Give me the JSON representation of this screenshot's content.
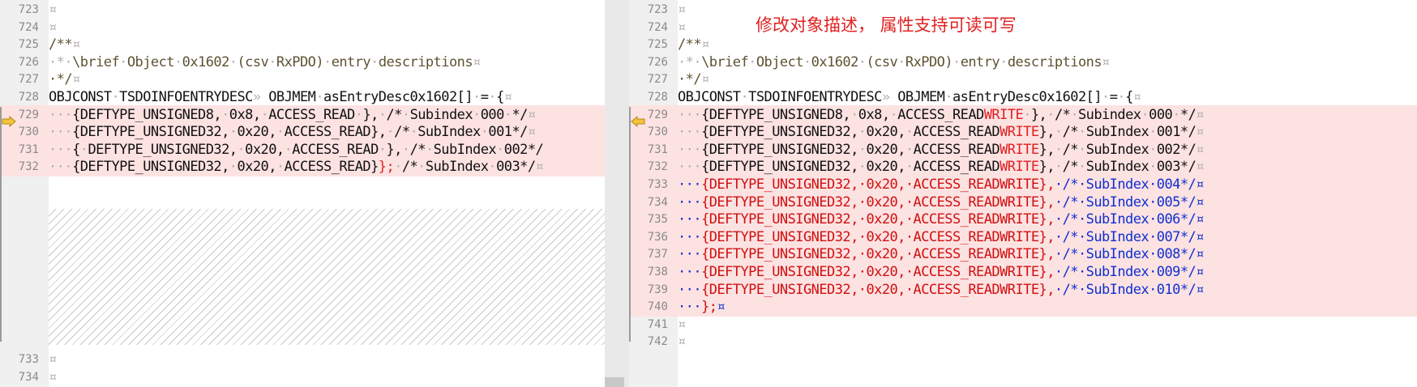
{
  "annotation": "修改对象描述， 属性支持可读可写",
  "left": {
    "lines_top": [
      {
        "n": "723",
        "kind": "blank",
        "segs": [
          {
            "t": "¤",
            "c": "ws"
          }
        ]
      },
      {
        "n": "724",
        "kind": "blank",
        "segs": [
          {
            "t": "¤",
            "c": "ws"
          }
        ]
      },
      {
        "n": "725",
        "kind": "comment",
        "segs": [
          {
            "t": "/**",
            "c": ""
          },
          {
            "t": "¤",
            "c": "ws"
          }
        ]
      },
      {
        "n": "726",
        "kind": "comment",
        "segs": [
          {
            "t": "·*·",
            "c": "ws"
          },
          {
            "t": "\\brief",
            "c": ""
          },
          {
            "t": "·",
            "c": "ws"
          },
          {
            "t": "Object",
            "c": ""
          },
          {
            "t": "·",
            "c": "ws"
          },
          {
            "t": "0x1602",
            "c": ""
          },
          {
            "t": "·",
            "c": "ws"
          },
          {
            "t": "(csv",
            "c": ""
          },
          {
            "t": "·",
            "c": "ws"
          },
          {
            "t": "RxPDO)",
            "c": ""
          },
          {
            "t": "·",
            "c": "ws"
          },
          {
            "t": "entry",
            "c": ""
          },
          {
            "t": "·",
            "c": "ws"
          },
          {
            "t": "descriptions",
            "c": ""
          },
          {
            "t": "¤",
            "c": "ws"
          }
        ]
      },
      {
        "n": "727",
        "kind": "comment",
        "segs": [
          {
            "t": "·*/",
            "c": ""
          },
          {
            "t": "¤",
            "c": "ws"
          }
        ]
      },
      {
        "n": "728",
        "kind": "code",
        "segs": [
          {
            "t": "OBJCONST",
            "c": ""
          },
          {
            "t": "·",
            "c": "ws"
          },
          {
            "t": "TSDOINFOENTRYDESC",
            "c": ""
          },
          {
            "t": "»",
            "c": "ws"
          },
          {
            "t": " OBJMEM",
            "c": ""
          },
          {
            "t": "·",
            "c": "ws"
          },
          {
            "t": "asEntryDesc0x1602[]",
            "c": ""
          },
          {
            "t": "·",
            "c": "ws"
          },
          {
            "t": "=",
            "c": ""
          },
          {
            "t": "·",
            "c": "ws"
          },
          {
            "t": "{",
            "c": ""
          },
          {
            "t": "¤",
            "c": "ws"
          }
        ]
      },
      {
        "n": "729",
        "kind": "changed",
        "segs": [
          {
            "t": "···",
            "c": "ws"
          },
          {
            "t": "{DEFTYPE_UNSIGNED8,",
            "c": ""
          },
          {
            "t": "·",
            "c": "ws"
          },
          {
            "t": "0x8,",
            "c": ""
          },
          {
            "t": "·",
            "c": "ws"
          },
          {
            "t": "ACCESS_READ",
            "c": ""
          },
          {
            "t": "·",
            "c": "ws"
          },
          {
            "t": "},",
            "c": ""
          },
          {
            "t": "·",
            "c": "ws"
          },
          {
            "t": "/*",
            "c": ""
          },
          {
            "t": "·",
            "c": "ws"
          },
          {
            "t": "Subindex",
            "c": ""
          },
          {
            "t": "·",
            "c": "ws"
          },
          {
            "t": "000",
            "c": ""
          },
          {
            "t": "·",
            "c": "ws"
          },
          {
            "t": "*/",
            "c": ""
          },
          {
            "t": "¤",
            "c": "ws"
          }
        ]
      },
      {
        "n": "730",
        "kind": "changed",
        "segs": [
          {
            "t": "···",
            "c": "ws"
          },
          {
            "t": "{DEFTYPE_UNSIGNED32,",
            "c": ""
          },
          {
            "t": "·",
            "c": "ws"
          },
          {
            "t": "0x20,",
            "c": ""
          },
          {
            "t": "·",
            "c": "ws"
          },
          {
            "t": "ACCESS_READ},",
            "c": ""
          },
          {
            "t": "·",
            "c": "ws"
          },
          {
            "t": "/*",
            "c": ""
          },
          {
            "t": "·",
            "c": "ws"
          },
          {
            "t": "SubIndex",
            "c": ""
          },
          {
            "t": "·",
            "c": "ws"
          },
          {
            "t": "001*/",
            "c": ""
          },
          {
            "t": "¤",
            "c": "ws"
          }
        ]
      },
      {
        "n": "731",
        "kind": "changed",
        "segs": [
          {
            "t": "···",
            "c": "ws"
          },
          {
            "t": "{",
            "c": ""
          },
          {
            "t": "·",
            "c": "ws"
          },
          {
            "t": "DEFTYPE_UNSIGNED32,",
            "c": ""
          },
          {
            "t": "·",
            "c": "ws"
          },
          {
            "t": "0x20,",
            "c": ""
          },
          {
            "t": "·",
            "c": "ws"
          },
          {
            "t": "ACCESS_READ",
            "c": ""
          },
          {
            "t": "·",
            "c": "ws"
          },
          {
            "t": "},",
            "c": ""
          },
          {
            "t": "·",
            "c": "ws"
          },
          {
            "t": "/*",
            "c": ""
          },
          {
            "t": "·",
            "c": "ws"
          },
          {
            "t": "SubIndex",
            "c": ""
          },
          {
            "t": "·",
            "c": "ws"
          },
          {
            "t": "002*/",
            "c": ""
          }
        ]
      },
      {
        "n": "732",
        "kind": "changed",
        "segs": [
          {
            "t": "···",
            "c": "ws"
          },
          {
            "t": "{DEFTYPE_UNSIGNED32,",
            "c": ""
          },
          {
            "t": "·",
            "c": "ws"
          },
          {
            "t": "0x20,",
            "c": ""
          },
          {
            "t": "·",
            "c": "ws"
          },
          {
            "t": "ACCESS_READ}",
            "c": ""
          },
          {
            "t": "};",
            "c": "ovr"
          },
          {
            "t": "·",
            "c": "ws"
          },
          {
            "t": "/*",
            "c": ""
          },
          {
            "t": "·",
            "c": "ws"
          },
          {
            "t": "SubIndex",
            "c": ""
          },
          {
            "t": "·",
            "c": "ws"
          },
          {
            "t": "003*/",
            "c": ""
          },
          {
            "t": "¤",
            "c": "ws"
          }
        ]
      }
    ],
    "lines_bottom": [
      {
        "n": "733",
        "kind": "blank",
        "segs": [
          {
            "t": "¤",
            "c": "ws"
          }
        ]
      },
      {
        "n": "734",
        "kind": "blank",
        "segs": [
          {
            "t": "¤",
            "c": "ws"
          }
        ]
      }
    ]
  },
  "right": {
    "lines": [
      {
        "n": "723",
        "kind": "blank",
        "segs": [
          {
            "t": "¤",
            "c": "ws"
          }
        ]
      },
      {
        "n": "724",
        "kind": "blank",
        "segs": [
          {
            "t": "¤",
            "c": "ws"
          }
        ]
      },
      {
        "n": "725",
        "kind": "comment",
        "segs": [
          {
            "t": "/**",
            "c": ""
          },
          {
            "t": "¤",
            "c": "ws"
          }
        ]
      },
      {
        "n": "726",
        "kind": "comment",
        "segs": [
          {
            "t": "·*·",
            "c": "ws"
          },
          {
            "t": "\\brief",
            "c": ""
          },
          {
            "t": "·",
            "c": "ws"
          },
          {
            "t": "Object",
            "c": ""
          },
          {
            "t": "·",
            "c": "ws"
          },
          {
            "t": "0x1602",
            "c": ""
          },
          {
            "t": "·",
            "c": "ws"
          },
          {
            "t": "(csv",
            "c": ""
          },
          {
            "t": "·",
            "c": "ws"
          },
          {
            "t": "RxPDO)",
            "c": ""
          },
          {
            "t": "·",
            "c": "ws"
          },
          {
            "t": "entry",
            "c": ""
          },
          {
            "t": "·",
            "c": "ws"
          },
          {
            "t": "descriptions",
            "c": ""
          },
          {
            "t": "¤",
            "c": "ws"
          }
        ]
      },
      {
        "n": "727",
        "kind": "comment",
        "segs": [
          {
            "t": "·*/",
            "c": ""
          },
          {
            "t": "¤",
            "c": "ws"
          }
        ]
      },
      {
        "n": "728",
        "kind": "code",
        "segs": [
          {
            "t": "OBJCONST",
            "c": ""
          },
          {
            "t": "·",
            "c": "ws"
          },
          {
            "t": "TSDOINFOENTRYDESC",
            "c": ""
          },
          {
            "t": "»",
            "c": "ws"
          },
          {
            "t": " OBJMEM",
            "c": ""
          },
          {
            "t": "·",
            "c": "ws"
          },
          {
            "t": "asEntryDesc0x1602[]",
            "c": ""
          },
          {
            "t": "·",
            "c": "ws"
          },
          {
            "t": "=",
            "c": ""
          },
          {
            "t": "·",
            "c": "ws"
          },
          {
            "t": "{",
            "c": ""
          },
          {
            "t": "¤",
            "c": "ws"
          }
        ]
      },
      {
        "n": "729",
        "kind": "changed",
        "segs": [
          {
            "t": "···",
            "c": "ws"
          },
          {
            "t": "{DEFTYPE_UNSIGNED8,",
            "c": ""
          },
          {
            "t": "·",
            "c": "ws"
          },
          {
            "t": "0x8,",
            "c": ""
          },
          {
            "t": "·",
            "c": "ws"
          },
          {
            "t": "ACCESS_READ",
            "c": ""
          },
          {
            "t": "WRITE",
            "c": "ovr"
          },
          {
            "t": "·",
            "c": "ws"
          },
          {
            "t": "},",
            "c": ""
          },
          {
            "t": "·",
            "c": "ws"
          },
          {
            "t": "/*",
            "c": ""
          },
          {
            "t": "·",
            "c": "ws"
          },
          {
            "t": "Subindex",
            "c": ""
          },
          {
            "t": "·",
            "c": "ws"
          },
          {
            "t": "000",
            "c": ""
          },
          {
            "t": "·",
            "c": "ws"
          },
          {
            "t": "*/",
            "c": ""
          },
          {
            "t": "¤",
            "c": "ws"
          }
        ]
      },
      {
        "n": "730",
        "kind": "changed",
        "segs": [
          {
            "t": "···",
            "c": "ws"
          },
          {
            "t": "{DEFTYPE_UNSIGNED32,",
            "c": ""
          },
          {
            "t": "·",
            "c": "ws"
          },
          {
            "t": "0x20,",
            "c": ""
          },
          {
            "t": "·",
            "c": "ws"
          },
          {
            "t": "ACCESS_READ",
            "c": ""
          },
          {
            "t": "WRITE",
            "c": "ovr"
          },
          {
            "t": "},",
            "c": ""
          },
          {
            "t": "·",
            "c": "ws"
          },
          {
            "t": "/*",
            "c": ""
          },
          {
            "t": "·",
            "c": "ws"
          },
          {
            "t": "SubIndex",
            "c": ""
          },
          {
            "t": "·",
            "c": "ws"
          },
          {
            "t": "001*/",
            "c": ""
          },
          {
            "t": "¤",
            "c": "ws"
          }
        ]
      },
      {
        "n": "731",
        "kind": "changed",
        "segs": [
          {
            "t": "···",
            "c": "ws"
          },
          {
            "t": "{DEFTYPE_UNSIGNED32,",
            "c": ""
          },
          {
            "t": "·",
            "c": "ws"
          },
          {
            "t": "0x20,",
            "c": ""
          },
          {
            "t": "·",
            "c": "ws"
          },
          {
            "t": "ACCESS_READ",
            "c": ""
          },
          {
            "t": "WRITE",
            "c": "ovr"
          },
          {
            "t": "},",
            "c": ""
          },
          {
            "t": "·",
            "c": "ws"
          },
          {
            "t": "/*",
            "c": ""
          },
          {
            "t": "·",
            "c": "ws"
          },
          {
            "t": "SubIndex",
            "c": ""
          },
          {
            "t": "·",
            "c": "ws"
          },
          {
            "t": "002*/",
            "c": ""
          },
          {
            "t": "¤",
            "c": "ws"
          }
        ]
      },
      {
        "n": "732",
        "kind": "changed",
        "segs": [
          {
            "t": "···",
            "c": "ws"
          },
          {
            "t": "{DEFTYPE_UNSIGNED32,",
            "c": ""
          },
          {
            "t": "·",
            "c": "ws"
          },
          {
            "t": "0x20,",
            "c": ""
          },
          {
            "t": "·",
            "c": "ws"
          },
          {
            "t": "ACCESS_READ",
            "c": ""
          },
          {
            "t": "WRITE",
            "c": "ovr"
          },
          {
            "t": "},",
            "c": ""
          },
          {
            "t": "·",
            "c": "ws"
          },
          {
            "t": "/*",
            "c": ""
          },
          {
            "t": "·",
            "c": "ws"
          },
          {
            "t": "SubIndex",
            "c": ""
          },
          {
            "t": "·",
            "c": "ws"
          },
          {
            "t": "003*/",
            "c": ""
          },
          {
            "t": "¤",
            "c": "ws"
          }
        ]
      },
      {
        "n": "733",
        "kind": "added",
        "segs": [
          {
            "t": "···",
            "c": "hl-blue"
          },
          {
            "t": "{DEFTYPE_UNSIGNED32,·0x20,·ACCESS_READWRITE},",
            "c": "hl-red"
          },
          {
            "t": "·/*·SubIndex·004*/¤",
            "c": "hl-blue"
          }
        ]
      },
      {
        "n": "734",
        "kind": "added",
        "segs": [
          {
            "t": "···",
            "c": "hl-blue"
          },
          {
            "t": "{DEFTYPE_UNSIGNED32,·0x20,·ACCESS_READWRITE},",
            "c": "hl-red"
          },
          {
            "t": "·/*·SubIndex·005*/¤",
            "c": "hl-blue"
          }
        ]
      },
      {
        "n": "735",
        "kind": "added",
        "segs": [
          {
            "t": "···",
            "c": "hl-blue"
          },
          {
            "t": "{DEFTYPE_UNSIGNED32,·0x20,·ACCESS_READWRITE},",
            "c": "hl-red"
          },
          {
            "t": "·/*·SubIndex·006*/¤",
            "c": "hl-blue"
          }
        ]
      },
      {
        "n": "736",
        "kind": "added",
        "segs": [
          {
            "t": "···",
            "c": "hl-blue"
          },
          {
            "t": "{DEFTYPE_UNSIGNED32,·0x20,·ACCESS_READWRITE},",
            "c": "hl-red"
          },
          {
            "t": "·/*·SubIndex·007*/¤",
            "c": "hl-blue"
          }
        ]
      },
      {
        "n": "737",
        "kind": "added",
        "segs": [
          {
            "t": "···",
            "c": "hl-blue"
          },
          {
            "t": "{DEFTYPE_UNSIGNED32,·0x20,·ACCESS_READWRITE},",
            "c": "hl-red"
          },
          {
            "t": "·/*·SubIndex·008*/¤",
            "c": "hl-blue"
          }
        ]
      },
      {
        "n": "738",
        "kind": "added",
        "segs": [
          {
            "t": "···",
            "c": "hl-blue"
          },
          {
            "t": "{DEFTYPE_UNSIGNED32,·0x20,·ACCESS_READWRITE},",
            "c": "hl-red"
          },
          {
            "t": "·/*·SubIndex·009*/¤",
            "c": "hl-blue"
          }
        ]
      },
      {
        "n": "739",
        "kind": "added",
        "segs": [
          {
            "t": "···",
            "c": "hl-blue"
          },
          {
            "t": "{DEFTYPE_UNSIGNED32,·0x20,·ACCESS_READWRITE},",
            "c": "hl-red"
          },
          {
            "t": "·/*·SubIndex·010*/¤",
            "c": "hl-blue"
          }
        ]
      },
      {
        "n": "740",
        "kind": "added",
        "segs": [
          {
            "t": "···",
            "c": "hl-blue"
          },
          {
            "t": "};",
            "c": "hl-red"
          },
          {
            "t": "¤",
            "c": "hl-blue"
          }
        ]
      },
      {
        "n": "741",
        "kind": "blank",
        "segs": [
          {
            "t": "¤",
            "c": "ws"
          }
        ]
      },
      {
        "n": "742",
        "kind": "blank",
        "segs": [
          {
            "t": "¤",
            "c": "ws"
          }
        ]
      }
    ]
  },
  "colors": {
    "changed_bg": "#fde2e2",
    "added_code": "#d01010",
    "added_marker": "#1030d0",
    "annotation": "#e02020",
    "arrow_fill": "#f5c23a"
  }
}
